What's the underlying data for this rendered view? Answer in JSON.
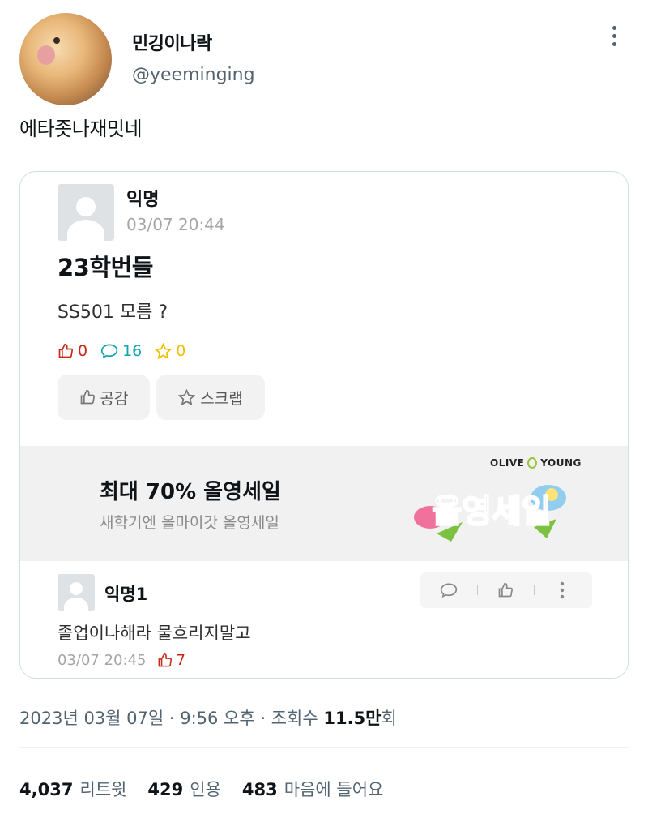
{
  "tweet": {
    "display_name": "민깅이나락",
    "handle": "@yeeminging",
    "text": "에타좃나재밋네",
    "timestamp": {
      "date_time": "2023년 03월 07일 · 9:56 오후 · 조회수 ",
      "views": "11.5만",
      "views_suffix": "회"
    },
    "engagement": {
      "retweets_count": "4,037",
      "retweets_label": "리트윗",
      "quotes_count": "429",
      "quotes_label": "인용",
      "likes_count": "483",
      "likes_label": "마음에 들어요"
    }
  },
  "post": {
    "author": "익명",
    "time": "03/07 20:44",
    "title": "23학번들",
    "body": "SS501 모름 ?",
    "stats": {
      "likes": "0",
      "comments": "16",
      "scraps": "0"
    },
    "buttons": {
      "like_label": "공감",
      "scrap_label": "스크랩"
    }
  },
  "ad": {
    "title": "최대 70% 올영세일",
    "subtitle": "새학기엔 올마이갓 올영세일",
    "brand_left": "OLIVE",
    "brand_right": "YOUNG",
    "logo_text": "올영세일"
  },
  "comment": {
    "author": "익명1",
    "text": "졸업이나해라 물흐리지말고",
    "time": "03/07 20:45",
    "likes": "7"
  },
  "colors": {
    "like_red": "#c62917",
    "comment_teal": "#0ca5b0",
    "scrap_yellow": "#f0c000",
    "muted_gray": "#536471"
  },
  "icons": [
    "more-vertical-icon",
    "thumbs-up-icon",
    "comment-icon",
    "star-icon",
    "user-placeholder-icon"
  ]
}
